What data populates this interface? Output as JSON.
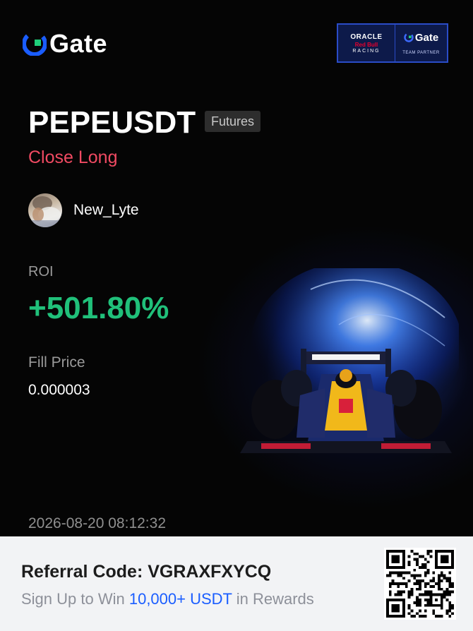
{
  "brand": {
    "name": "Gate",
    "icon": "gate-logo-icon",
    "accent": "#1a5dff"
  },
  "partner_badge": {
    "line1": "ORACLE",
    "line2": "Red Bull",
    "line3": "RACING",
    "brand": "Gate",
    "caption": "TEAM PARTNER"
  },
  "trade": {
    "pair": "PEPEUSDT",
    "market_type": "Futures",
    "action": "Close Long",
    "action_color": "#f04a62"
  },
  "user": {
    "name": "New_Lyte",
    "avatar_icon": "avatar-photo"
  },
  "roi": {
    "label": "ROI",
    "value": "+501.80%",
    "color": "#20c07a"
  },
  "fill_price": {
    "label": "Fill Price",
    "value": "0.000003"
  },
  "timestamp": "2026-08-20 08:12:32",
  "footer": {
    "referral_label": "Referral Code: ",
    "referral_code": "VGRAXFXYCQ",
    "promo_prefix": "Sign Up to Win ",
    "promo_highlight": "10,000+ USDT",
    "promo_suffix": " in Rewards",
    "qr_icon": "qr-code-icon"
  }
}
